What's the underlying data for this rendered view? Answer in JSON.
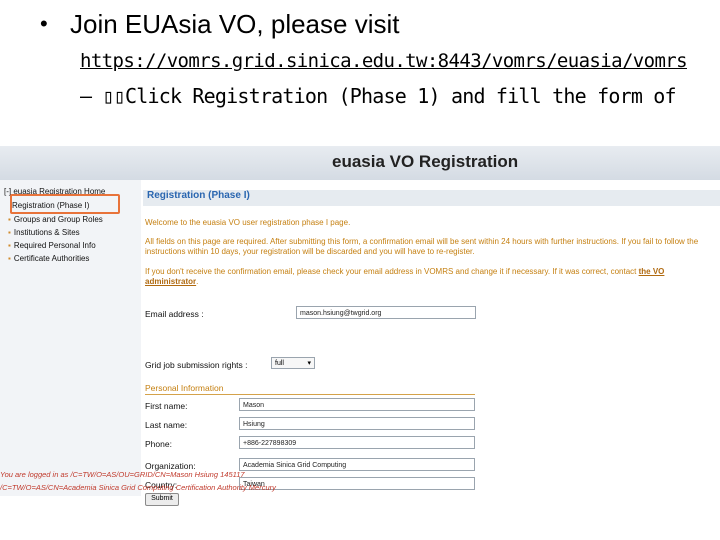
{
  "slide": {
    "bullet_symbol": "•",
    "bullet_text": "Join EUAsia VO, please visit",
    "url": "https://vomrs.grid.sinica.edu.tw:8443/vomrs/euasia/vomrs",
    "dash": "–",
    "instruction": "▯▯Click Registration (Phase 1) and fill the form of"
  },
  "screenshot": {
    "page_title": "euasia VO Registration",
    "sidebar": {
      "home_label": "[-] euasia Registration Home",
      "items": [
        "Registration (Phase I)",
        "Groups and Group Roles",
        "Institutions & Sites",
        "Required Personal Info",
        "Certificate Authorities"
      ]
    },
    "section_title": "Registration (Phase I)",
    "welcome": "Welcome to the euasia VO user registration phase I page.",
    "info_1": "All fields on this page are required. After submitting this form, a confirmation email will be sent within 24 hours with further instructions. If you fail to follow the instructions within 10 days, your registration will be discarded and you will have to re-register.",
    "info_2_prefix": "If you don't receive the confirmation email, please check your email address in VOMRS and change it if necessary. If it was correct, contact ",
    "info_2_link": "the VO administrator",
    "info_2_suffix": ".",
    "email_label": "Email address :",
    "email_value": "mason.hsiung@twgrid.org",
    "rights_label": "Grid job submission rights :",
    "rights_value": "full",
    "personal_header": "Personal Information",
    "fields": [
      {
        "label": "First name:",
        "value": "Mason"
      },
      {
        "label": "Last name:",
        "value": "Hsiung"
      },
      {
        "label": "Phone:",
        "value": "+886-227898309"
      },
      {
        "label": "Organization:",
        "value": "Academia Sinica Grid Computing"
      },
      {
        "label": "Country:",
        "value": "Taiwan"
      }
    ],
    "submit_label": "Submit",
    "footer_1": "You are logged in as /C=TW/O=AS/OU=GRID/CN=Mason Hsiung 145117",
    "footer_2": "/C=TW/O=AS/CN=Academia Sinica Grid Computing Certification Authority Mercury"
  },
  "colors": {
    "highlight": "#e8733a",
    "section_title": "#2a66b0",
    "info_text": "#c58012",
    "footer_text": "#c0392b"
  }
}
